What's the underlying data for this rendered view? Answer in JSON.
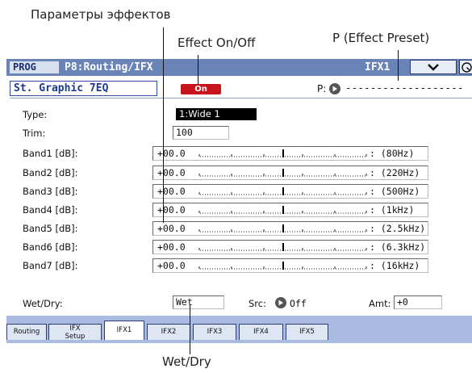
{
  "annotations": {
    "effect_params": "Параметры эффектов",
    "effect_on_off": "Effect On/Off",
    "effect_preset": "P (Effect Preset)",
    "wet_dry": "Wet/Dry"
  },
  "header": {
    "mode": "PROG",
    "page": "P8:Routing/IFX",
    "slot": "IFX1"
  },
  "effect": {
    "name": "St. Graphic 7EQ",
    "on_label": "On",
    "preset_label": "P:",
    "preset_value": "-------------------"
  },
  "params": {
    "type_label": "Type:",
    "type_value": "1:Wide 1",
    "trim_label": "Trim:",
    "trim_value": "100",
    "bands": [
      {
        "label": "Band1 [dB]:",
        "value": "+00.0",
        "freq": ": (80Hz)"
      },
      {
        "label": "Band2 [dB]:",
        "value": "+00.0",
        "freq": ": (220Hz)"
      },
      {
        "label": "Band3 [dB]:",
        "value": "+00.0",
        "freq": ": (500Hz)"
      },
      {
        "label": "Band4 [dB]:",
        "value": "+00.0",
        "freq": ": (1kHz)"
      },
      {
        "label": "Band5 [dB]:",
        "value": "+00.0",
        "freq": ": (2.5kHz)"
      },
      {
        "label": "Band6 [dB]:",
        "value": "+00.0",
        "freq": ": (6.3kHz)"
      },
      {
        "label": "Band7 [dB]:",
        "value": "+00.0",
        "freq": ": (16kHz)"
      }
    ],
    "wetdry_label": "Wet/Dry:",
    "wetdry_value": "Wet",
    "src_label": "Src:",
    "src_value": "Off",
    "amt_label": "Amt:",
    "amt_value": "+0"
  },
  "tabs": [
    {
      "label": "Routing",
      "line2": ""
    },
    {
      "label": "IFX",
      "line2": "Setup"
    },
    {
      "label": "IFX1",
      "line2": ""
    },
    {
      "label": "IFX2",
      "line2": ""
    },
    {
      "label": "IFX3",
      "line2": ""
    },
    {
      "label": "IFX4",
      "line2": ""
    },
    {
      "label": "IFX5",
      "line2": ""
    }
  ],
  "colors": {
    "header_bar": "#6b84b8",
    "on_button": "#c8141c",
    "tab_bar": "#a9bbe0"
  }
}
